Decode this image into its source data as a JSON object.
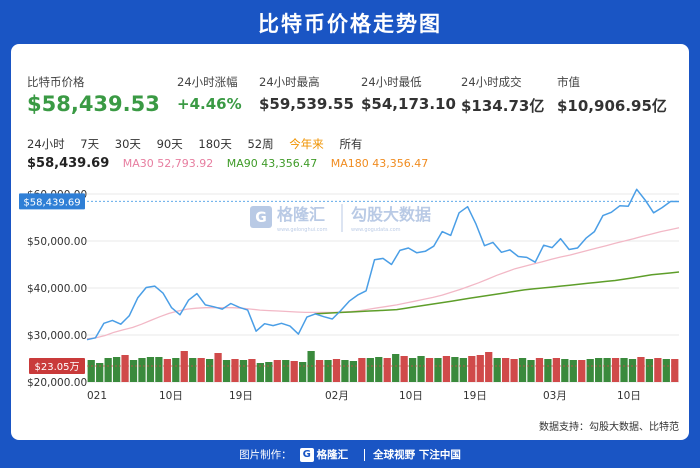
{
  "header": {
    "title": "比特币价格走势图"
  },
  "stats": {
    "price": {
      "label": "比特币价格",
      "value": "$58,439.53"
    },
    "change": {
      "label": "24小时涨幅",
      "value": "+4.46%"
    },
    "high": {
      "label": "24小时最高",
      "value": "$59,539.55"
    },
    "low": {
      "label": "24小时最低",
      "value": "$54,173.10"
    },
    "volume": {
      "label": "24小时成交",
      "value": "$134.73亿"
    },
    "mcap": {
      "label": "市值",
      "value": "$10,906.95亿"
    }
  },
  "ranges": [
    "24小时",
    "7天",
    "30天",
    "90天",
    "180天",
    "52周",
    "今年来",
    "所有"
  ],
  "active_range": "今年来",
  "ma": {
    "current": "$58,439.69",
    "ma30": "MA30 52,793.92",
    "ma90": "MA90 43,356.47",
    "ma180": "MA180 43,356.47"
  },
  "watermark": {
    "brand1": "格隆汇",
    "sub1": "www.gelonghui.com",
    "brand2": "勾股大数据",
    "sub2": "www.gogudata.com"
  },
  "source": "数据支持：勾股大数据、比特范",
  "footer": {
    "made_by": "图片制作：",
    "logo_char": "G",
    "brand": "格隆汇",
    "slogan": "全球视野 下注中国"
  },
  "colors": {
    "background": "#1a55c4",
    "price_line": "#4a9ee6",
    "ma30": "#f2b8c6",
    "ma90": "#5e9e2a",
    "bar_green": "#3a8a3c",
    "bar_red": "#d04a4a",
    "up_green": "#3a9a44"
  },
  "chart_data": {
    "type": "line",
    "x_tick_labels": [
      "021",
      "10日",
      "19日",
      "02月",
      "10日",
      "19日",
      "03月",
      "10日"
    ],
    "y_tick_labels": [
      "$20,000.00",
      "$30,000.00",
      "$40,000.00",
      "$50,000.00",
      "$60,000.00"
    ],
    "ylim": [
      20000,
      60000
    ],
    "current_price_label": "$58,439.69",
    "current_price": 58440,
    "current_volume_label": "$23.05万",
    "series": [
      {
        "name": "MA30 52,793.92",
        "values": [
          29200,
          29400,
          29900,
          30600,
          31100,
          31600,
          32300,
          33100,
          33900,
          34600,
          35100,
          35500,
          35700,
          35800,
          35800,
          35800,
          35800,
          35700,
          35500,
          35300,
          35200,
          35100,
          35000,
          34900,
          34800,
          34800,
          34800,
          34800,
          34900,
          35000,
          35200,
          35500,
          35800,
          36100,
          36400,
          36800,
          37200,
          37600,
          38000,
          38500,
          39100,
          39700,
          40400,
          41100,
          41900,
          42700,
          43400,
          44100,
          44600,
          45100,
          45600,
          46100,
          46600,
          47000,
          47500,
          48000,
          48500,
          49000,
          49500,
          50000,
          50500,
          51000,
          51500,
          52000,
          52400,
          52800
        ]
      },
      {
        "name": "MA90 43,356.47",
        "values": [
          null,
          null,
          null,
          null,
          null,
          null,
          null,
          null,
          null,
          null,
          null,
          null,
          null,
          null,
          null,
          null,
          null,
          null,
          null,
          null,
          null,
          null,
          null,
          null,
          null,
          34500,
          34600,
          34700,
          34800,
          34900,
          35000,
          35100,
          35200,
          35300,
          35400,
          35700,
          36000,
          36300,
          36600,
          36900,
          37200,
          37500,
          37800,
          38100,
          38400,
          38700,
          39000,
          39300,
          39600,
          39800,
          40000,
          40200,
          40400,
          40600,
          40800,
          41000,
          41200,
          41400,
          41600,
          41900,
          42200,
          42500,
          42800,
          43000,
          43200,
          43400
        ]
      },
      {
        "name": "price",
        "values": [
          29000,
          29400,
          32500,
          33100,
          32300,
          34100,
          37900,
          40100,
          40400,
          38900,
          35800,
          34300,
          37400,
          38800,
          36400,
          36000,
          35500,
          36700,
          35900,
          35300,
          30800,
          32400,
          32000,
          32500,
          31900,
          30200,
          33800,
          34500,
          33900,
          33400,
          35200,
          37200,
          38500,
          39400,
          46000,
          46300,
          45000,
          48000,
          48500,
          47500,
          47800,
          48900,
          52000,
          51200,
          56000,
          57300,
          53600,
          49000,
          49700,
          47600,
          48100,
          46700,
          46500,
          45500,
          49100,
          48600,
          50500,
          48200,
          48500,
          50600,
          52000,
          55400,
          56100,
          57500,
          57400,
          61000,
          58700,
          56000,
          57100,
          58400,
          58400
        ]
      }
    ],
    "volume_bars": [
      {
        "v": 22,
        "up": true
      },
      {
        "v": 19,
        "up": true
      },
      {
        "v": 24,
        "up": true
      },
      {
        "v": 25,
        "up": true
      },
      {
        "v": 27,
        "up": false
      },
      {
        "v": 22,
        "up": true
      },
      {
        "v": 24,
        "up": true
      },
      {
        "v": 25,
        "up": true
      },
      {
        "v": 25,
        "up": true
      },
      {
        "v": 23,
        "up": false
      },
      {
        "v": 24,
        "up": true
      },
      {
        "v": 31,
        "up": false
      },
      {
        "v": 24,
        "up": true
      },
      {
        "v": 24,
        "up": false
      },
      {
        "v": 23,
        "up": true
      },
      {
        "v": 29,
        "up": false
      },
      {
        "v": 22,
        "up": true
      },
      {
        "v": 23,
        "up": false
      },
      {
        "v": 22,
        "up": true
      },
      {
        "v": 23,
        "up": false
      },
      {
        "v": 19,
        "up": true
      },
      {
        "v": 20,
        "up": true
      },
      {
        "v": 22,
        "up": false
      },
      {
        "v": 22,
        "up": true
      },
      {
        "v": 21,
        "up": false
      },
      {
        "v": 20,
        "up": true
      },
      {
        "v": 31,
        "up": true
      },
      {
        "v": 22,
        "up": false
      },
      {
        "v": 22,
        "up": true
      },
      {
        "v": 23,
        "up": false
      },
      {
        "v": 22,
        "up": true
      },
      {
        "v": 21,
        "up": true
      },
      {
        "v": 24,
        "up": false
      },
      {
        "v": 24,
        "up": true
      },
      {
        "v": 25,
        "up": true
      },
      {
        "v": 24,
        "up": false
      },
      {
        "v": 28,
        "up": true
      },
      {
        "v": 26,
        "up": false
      },
      {
        "v": 24,
        "up": true
      },
      {
        "v": 26,
        "up": true
      },
      {
        "v": 24,
        "up": false
      },
      {
        "v": 24,
        "up": true
      },
      {
        "v": 26,
        "up": false
      },
      {
        "v": 25,
        "up": true
      },
      {
        "v": 24,
        "up": true
      },
      {
        "v": 26,
        "up": false
      },
      {
        "v": 27,
        "up": false
      },
      {
        "v": 30,
        "up": false
      },
      {
        "v": 24,
        "up": true
      },
      {
        "v": 24,
        "up": false
      },
      {
        "v": 23,
        "up": false
      },
      {
        "v": 24,
        "up": true
      },
      {
        "v": 22,
        "up": true
      },
      {
        "v": 24,
        "up": false
      },
      {
        "v": 23,
        "up": true
      },
      {
        "v": 24,
        "up": false
      },
      {
        "v": 23,
        "up": true
      },
      {
        "v": 22,
        "up": true
      },
      {
        "v": 22,
        "up": false
      },
      {
        "v": 23,
        "up": true
      },
      {
        "v": 24,
        "up": true
      },
      {
        "v": 24,
        "up": true
      },
      {
        "v": 24,
        "up": false
      },
      {
        "v": 24,
        "up": true
      },
      {
        "v": 23,
        "up": true
      },
      {
        "v": 25,
        "up": false
      },
      {
        "v": 23,
        "up": true
      },
      {
        "v": 24,
        "up": false
      },
      {
        "v": 23,
        "up": true
      },
      {
        "v": 23,
        "up": false
      }
    ]
  }
}
